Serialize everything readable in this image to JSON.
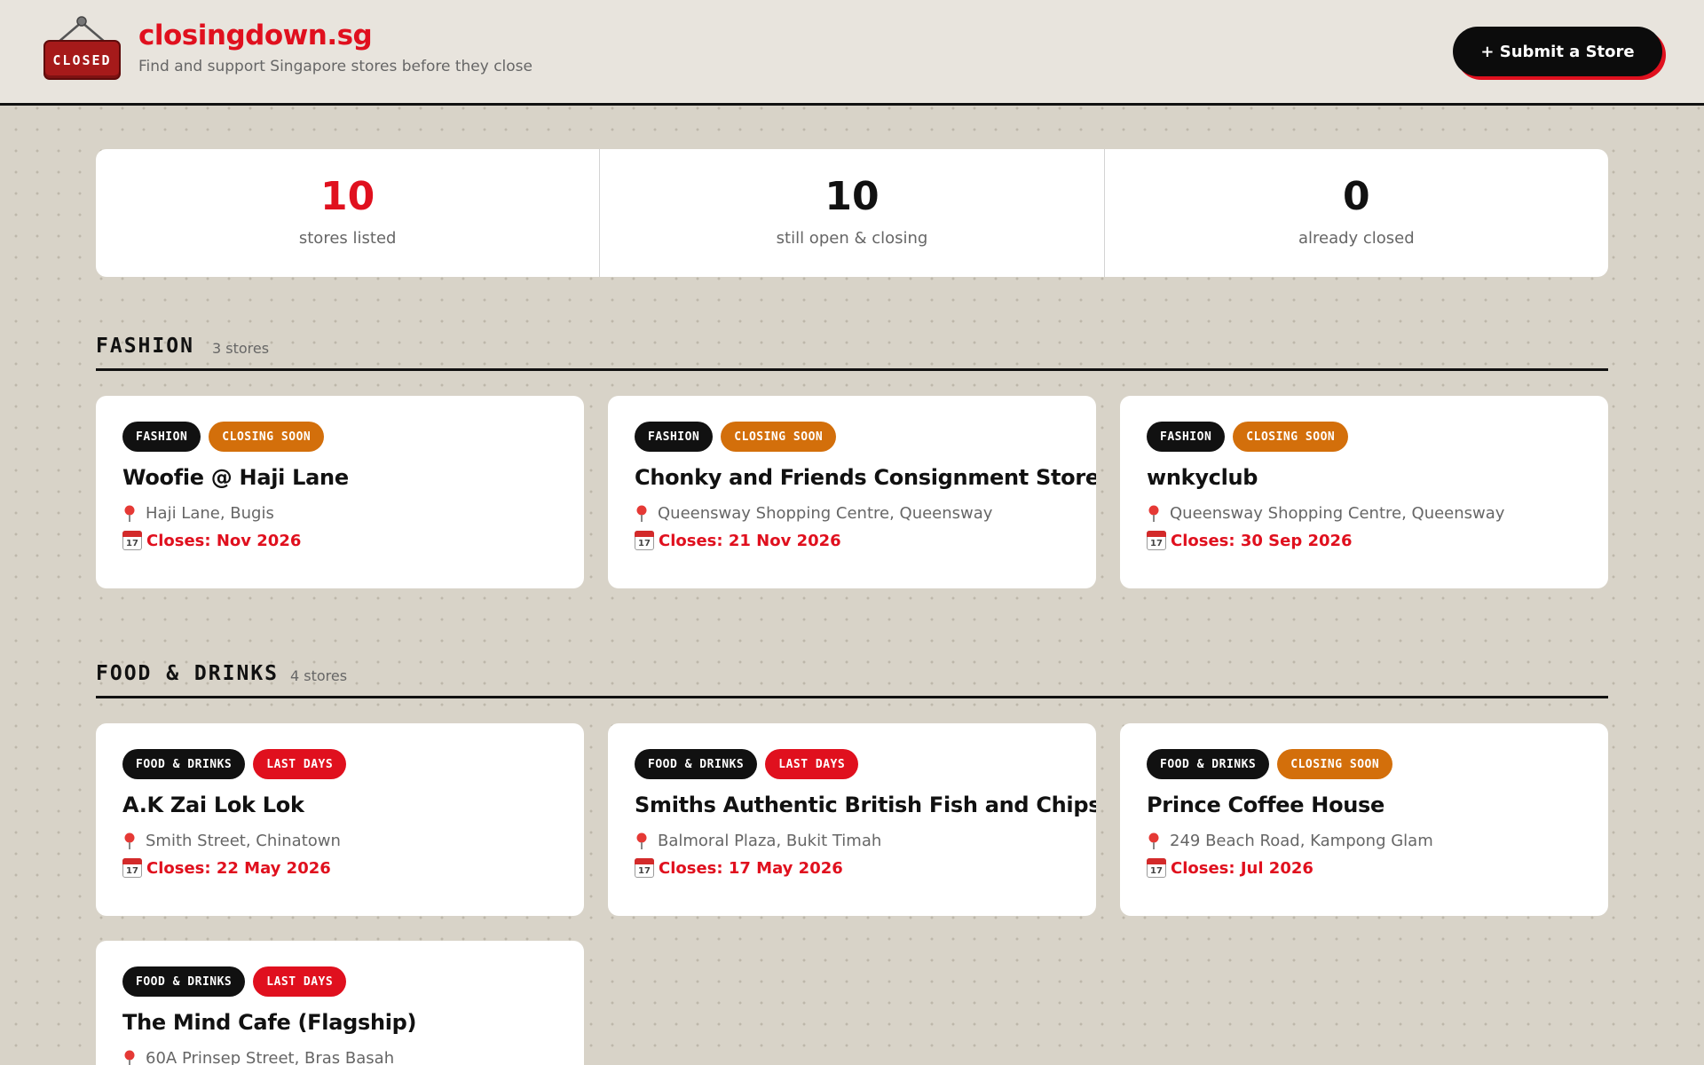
{
  "header": {
    "logo_text": "CLOSED",
    "brand": "closingdown.sg",
    "tagline": "Find and support Singapore stores before they close",
    "submit_label": "+ Submit a Store"
  },
  "stats": [
    {
      "value": "10",
      "label": "stores listed"
    },
    {
      "value": "10",
      "label": "still open & closing"
    },
    {
      "value": "0",
      "label": "already closed"
    }
  ],
  "sections": [
    {
      "title": "FASHION",
      "count": "3 stores",
      "stores": [
        {
          "category": "FASHION",
          "status": "CLOSING SOON",
          "name": "Woofie @ Haji Lane",
          "location": "Haji Lane, Bugis",
          "closes": "Closes: Nov 2026"
        },
        {
          "category": "FASHION",
          "status": "CLOSING SOON",
          "name": "Chonky and Friends Consignment Store",
          "location": "Queensway Shopping Centre, Queensway",
          "closes": "Closes: 21 Nov 2026"
        },
        {
          "category": "FASHION",
          "status": "CLOSING SOON",
          "name": "wnkyclub",
          "location": "Queensway Shopping Centre, Queensway",
          "closes": "Closes: 30 Sep 2026"
        }
      ]
    },
    {
      "title": "FOOD & DRINKS",
      "count": "4 stores",
      "stores": [
        {
          "category": "FOOD & DRINKS",
          "status": "LAST DAYS",
          "name": "A.K Zai Lok Lok",
          "location": "Smith Street, Chinatown",
          "closes": "Closes: 22 May 2026"
        },
        {
          "category": "FOOD & DRINKS",
          "status": "LAST DAYS",
          "name": "Smiths Authentic British Fish and Chips",
          "location": "Balmoral Plaza, Bukit Timah",
          "closes": "Closes: 17 May 2026"
        },
        {
          "category": "FOOD & DRINKS",
          "status": "CLOSING SOON",
          "name": "Prince Coffee House",
          "location": "249 Beach Road, Kampong Glam",
          "closes": "Closes: Jul 2026"
        },
        {
          "category": "FOOD & DRINKS",
          "status": "LAST DAYS",
          "name": "The Mind Cafe (Flagship)",
          "location": "60A Prinsep Street, Bras Basah",
          "closes": ""
        }
      ]
    }
  ],
  "icons": {
    "pin": "location-pin-icon",
    "calendar": "calendar-icon",
    "calendar_day": "17",
    "logo": "closed-sign-logo"
  },
  "colors": {
    "accent": "#e0101e",
    "closing_soon": "#d36f0b",
    "last_days": "#e0101e",
    "category": "#111111",
    "background": "#d8d3c8"
  }
}
